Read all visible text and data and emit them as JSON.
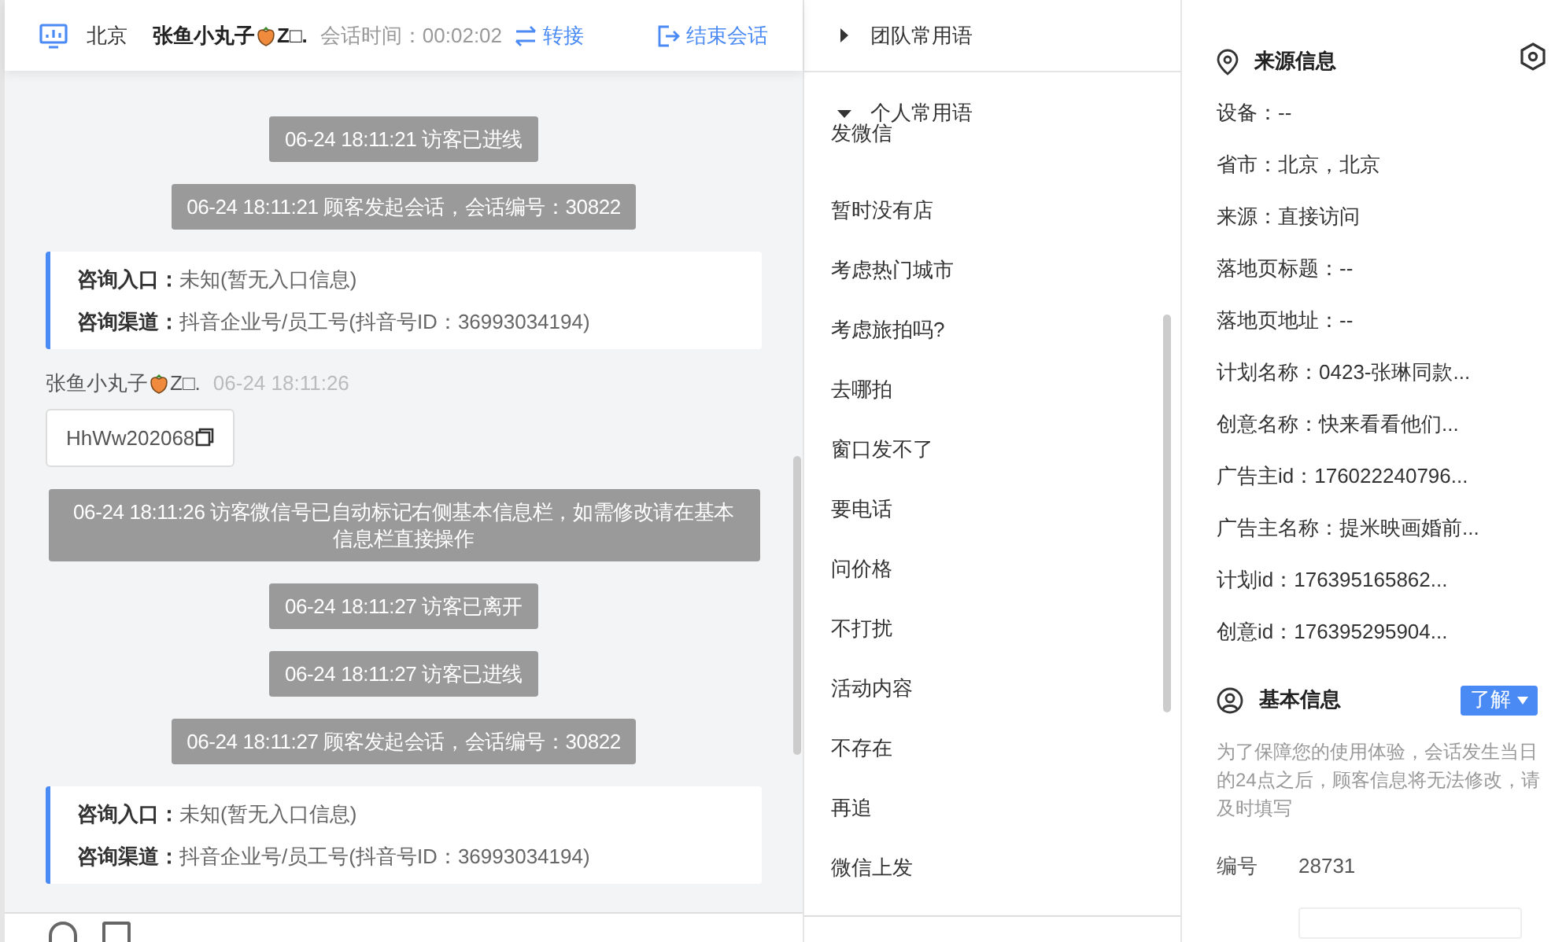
{
  "header": {
    "city": "北京",
    "visitor_name": "张鱼小丸子",
    "visitor_suffix": "Z□.",
    "duration_label": "会话时间：",
    "duration": "00:02:02",
    "actions": [
      {
        "kind": "transfer",
        "label": "转接"
      },
      {
        "kind": "end",
        "label": "结束会话"
      }
    ]
  },
  "messages": [
    {
      "kind": "system",
      "text": "06-24 18:11:21 访客已进线"
    },
    {
      "kind": "system",
      "text": "06-24 18:11:21 顾客发起会话，会话编号：30822"
    },
    {
      "kind": "info",
      "lines": [
        {
          "label": "咨询入口：",
          "value": "未知(暂无入口信息)"
        },
        {
          "label": "咨询渠道：",
          "value": "抖音企业号/员工号(抖音号ID：36993034194)"
        }
      ]
    },
    {
      "kind": "visitor",
      "name": "张鱼小丸子",
      "suffix": "Z□.",
      "time": "06-24 18:11:26",
      "text": "HhWw202068"
    },
    {
      "kind": "system",
      "text": "06-24 18:11:26 访客微信号已自动标记右侧基本信息栏，如需修改请在基本信息栏直接操作"
    },
    {
      "kind": "system",
      "text": "06-24 18:11:27 访客已离开"
    },
    {
      "kind": "system",
      "text": "06-24 18:11:27 访客已进线"
    },
    {
      "kind": "system",
      "text": "06-24 18:11:27 顾客发起会话，会话编号：30822"
    },
    {
      "kind": "info",
      "lines": [
        {
          "label": "咨询入口：",
          "value": "未知(暂无入口信息)"
        },
        {
          "label": "咨询渠道：",
          "value": "抖音企业号/员工号(抖音号ID：36993034194)"
        }
      ]
    }
  ],
  "phrase_groups": [
    {
      "title": "团队常用语",
      "expanded": false
    },
    {
      "title": "个人常用语",
      "expanded": true,
      "items": [
        "发微信",
        "暂时没有店",
        "考虑热门城市",
        "考虑旅拍吗?",
        "去哪拍",
        "窗口发不了",
        "要电话",
        "问价格",
        "不打扰",
        "活动内容",
        "不存在",
        "再追",
        "微信上发"
      ]
    }
  ],
  "source_info": {
    "title": "来源信息",
    "fields": [
      "设备：--",
      "省市：北京，北京",
      "来源：直接访问",
      "落地页标题：--",
      "落地页地址：--",
      "计划名称：0423-张琳同款...",
      "创意名称：快来看看他们...",
      "广告主id：176022240796...",
      "广告主名称：提米映画婚前...",
      "计划id：176395165862...",
      "创意id：176395295904..."
    ]
  },
  "basic_info": {
    "title": "基本信息",
    "button": "了解",
    "notice": "为了保障您的使用体验，会话发生当日的24点之后，顾客信息将无法修改，请及时填写",
    "id_label": "编号",
    "id_value": "28731"
  }
}
